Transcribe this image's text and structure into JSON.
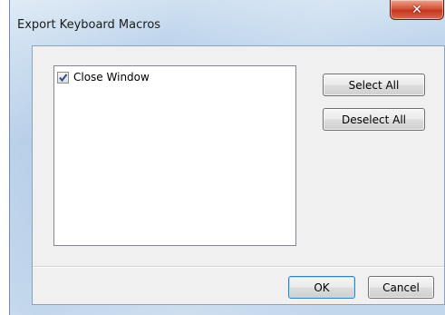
{
  "window": {
    "title": "Export Keyboard Macros",
    "close_icon": "close-icon"
  },
  "macros": {
    "items": [
      {
        "label": "Close Window",
        "checked": true
      }
    ]
  },
  "buttons": {
    "select_all": "Select All",
    "deselect_all": "Deselect All",
    "ok": "OK",
    "cancel": "Cancel"
  },
  "colors": {
    "close_button": "#c7391f",
    "default_button_border": "#3c7fb1",
    "frame": "#b9d1ea"
  }
}
